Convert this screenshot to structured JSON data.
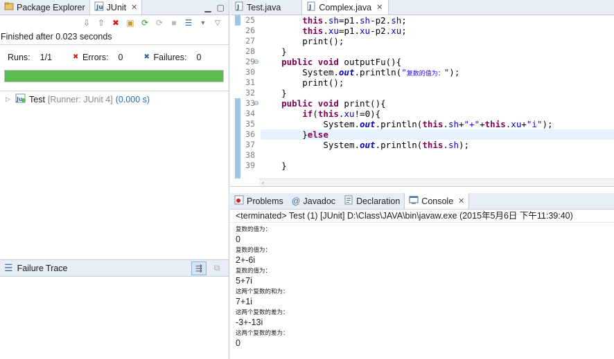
{
  "left_tabs": {
    "package_explorer": "Package Explorer",
    "junit": "JUnit"
  },
  "junit": {
    "finished": "Finished after 0.023 seconds",
    "runs_label": "Runs:",
    "runs_value": "1/1",
    "errors_label": "Errors:",
    "errors_value": "0",
    "failures_label": "Failures:",
    "failures_value": "0",
    "progress_fraction": 1.0,
    "progress_color": "#5cba50",
    "test_name": "Test",
    "test_runner": "[Runner: JUnit 4]",
    "test_time": "(0.000 s)"
  },
  "failure_trace": {
    "label": "Failure Trace"
  },
  "editor_tabs": [
    {
      "label": "Test.java",
      "active": false
    },
    {
      "label": "Complex.java",
      "active": true
    }
  ],
  "editor": {
    "line_numbers": [
      "25",
      "26",
      "27",
      "28",
      "29",
      "30",
      "31",
      "32",
      "33",
      "34",
      "35",
      "36",
      "37",
      "38",
      "39"
    ],
    "lines": [
      {
        "indent": "        ",
        "parts": [
          [
            "kw",
            "this"
          ],
          [
            "",
            "."
          ],
          [
            "fld",
            "sh"
          ],
          [
            "",
            "=p1."
          ],
          [
            "fld",
            "sh"
          ],
          [
            "",
            "-p2."
          ],
          [
            "fld",
            "sh"
          ],
          [
            "",
            ";"
          ]
        ]
      },
      {
        "indent": "        ",
        "parts": [
          [
            "kw",
            "this"
          ],
          [
            "",
            "."
          ],
          [
            "fld",
            "xu"
          ],
          [
            "",
            "=p1."
          ],
          [
            "fld",
            "xu"
          ],
          [
            "",
            "-p2."
          ],
          [
            "fld",
            "xu"
          ],
          [
            "",
            ";"
          ]
        ]
      },
      {
        "indent": "        ",
        "parts": [
          [
            "",
            "print();"
          ]
        ]
      },
      {
        "indent": "    ",
        "parts": [
          [
            "",
            "}"
          ]
        ]
      },
      {
        "indent": "    ",
        "parts": [
          [
            "kw",
            "public"
          ],
          [
            "",
            " "
          ],
          [
            "kw",
            "void"
          ],
          [
            "",
            " outputFu(){"
          ]
        ]
      },
      {
        "indent": "        ",
        "parts": [
          [
            "",
            "System."
          ],
          [
            "it",
            "out"
          ],
          [
            "",
            ".println("
          ],
          [
            "str",
            "\""
          ],
          [
            "str cjk",
            "复数的值为："
          ],
          [
            "str",
            "\""
          ],
          [
            "",
            ");"
          ]
        ]
      },
      {
        "indent": "        ",
        "parts": [
          [
            "",
            "print();"
          ]
        ]
      },
      {
        "indent": "    ",
        "parts": [
          [
            "",
            "}"
          ]
        ]
      },
      {
        "indent": "    ",
        "parts": [
          [
            "kw",
            "public"
          ],
          [
            "",
            " "
          ],
          [
            "kw",
            "void"
          ],
          [
            "",
            " print(){"
          ]
        ]
      },
      {
        "indent": "        ",
        "parts": [
          [
            "kw",
            "if"
          ],
          [
            "",
            "("
          ],
          [
            "kw",
            "this"
          ],
          [
            "",
            "."
          ],
          [
            "fld",
            "xu"
          ],
          [
            "",
            "!=0){"
          ]
        ]
      },
      {
        "indent": "            ",
        "parts": [
          [
            "",
            "System."
          ],
          [
            "it",
            "out"
          ],
          [
            "",
            ".println("
          ],
          [
            "kw",
            "this"
          ],
          [
            "",
            "."
          ],
          [
            "fld",
            "sh"
          ],
          [
            "",
            "+"
          ],
          [
            "str",
            "\"+\""
          ],
          [
            "",
            "+"
          ],
          [
            "kw",
            "this"
          ],
          [
            "",
            "."
          ],
          [
            "fld",
            "xu"
          ],
          [
            "",
            "+"
          ],
          [
            "str",
            "\"i\""
          ],
          [
            "",
            ");"
          ]
        ]
      },
      {
        "indent": "        ",
        "parts": [
          [
            "",
            "}"
          ],
          [
            "kw",
            "else"
          ]
        ]
      },
      {
        "indent": "            ",
        "parts": [
          [
            "",
            "System."
          ],
          [
            "it",
            "out"
          ],
          [
            "",
            ".println("
          ],
          [
            "kw",
            "this"
          ],
          [
            "",
            "."
          ],
          [
            "fld",
            "sh"
          ],
          [
            "",
            ");"
          ]
        ]
      },
      {
        "indent": "",
        "parts": []
      },
      {
        "indent": "    ",
        "parts": [
          [
            "",
            "}"
          ]
        ]
      }
    ],
    "highlighted_line": 11,
    "fold_lines": [
      4,
      8
    ]
  },
  "bottom_tabs": [
    {
      "label": "Problems",
      "icon": "problems-icon",
      "active": false
    },
    {
      "label": "Javadoc",
      "icon": "at-icon",
      "active": false
    },
    {
      "label": "Declaration",
      "icon": "declaration-icon",
      "active": false
    },
    {
      "label": "Console",
      "icon": "console-icon",
      "active": true
    }
  ],
  "console": {
    "title": "<terminated> Test (1) [JUnit] D:\\Class\\JAVA\\bin\\javaw.exe (2015年5月6日 下午11:39:40)",
    "output": [
      {
        "text": "复数的值为：",
        "small": true
      },
      {
        "text": "0",
        "small": false
      },
      {
        "text": "复数的值为：",
        "small": true
      },
      {
        "text": "2+-6i",
        "small": false
      },
      {
        "text": "复数的值为：",
        "small": true
      },
      {
        "text": "5+7i",
        "small": false
      },
      {
        "text": "这两个复数的和为：",
        "small": true
      },
      {
        "text": "7+1i",
        "small": false
      },
      {
        "text": "这两个复数的差为：",
        "small": true
      },
      {
        "text": "-3+-13i",
        "small": false
      },
      {
        "text": "这两个复数的差为：",
        "small": true
      },
      {
        "text": "0",
        "small": false
      }
    ]
  }
}
